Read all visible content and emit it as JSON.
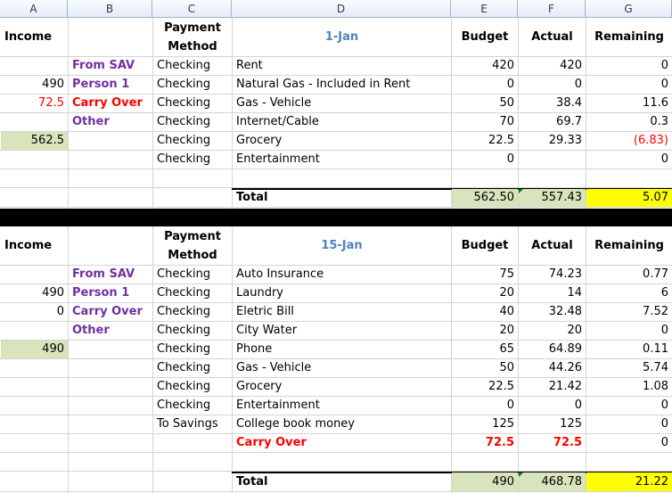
{
  "columns": [
    "A",
    "B",
    "C",
    "D",
    "E",
    "F",
    "G"
  ],
  "sections": [
    {
      "header": {
        "income": "Income",
        "payment1": "Payment",
        "payment2": "Method",
        "date": "1-Jan",
        "budget": "Budget",
        "actual": "Actual",
        "remaining": "Remaining"
      },
      "income_rows": [
        {
          "amount": "",
          "label": "From SAV",
          "style": "purple"
        },
        {
          "amount": "490",
          "label": "Person 1",
          "style": "purple"
        },
        {
          "amount": "72.5",
          "label": "Carry Over",
          "style": "redb"
        },
        {
          "amount": "",
          "label": "Other",
          "style": "purple"
        }
      ],
      "income_total": "562.5",
      "items": [
        {
          "method": "Checking",
          "desc": "Rent",
          "budget": "420",
          "actual": "420",
          "remaining": "0"
        },
        {
          "method": "Checking",
          "desc": "Natural Gas - Included in Rent",
          "budget": "0",
          "actual": "0",
          "remaining": "0"
        },
        {
          "method": "Checking",
          "desc": "Gas - Vehicle",
          "budget": "50",
          "actual": "38.4",
          "remaining": "11.6"
        },
        {
          "method": "Checking",
          "desc": "Internet/Cable",
          "budget": "70",
          "actual": "69.7",
          "remaining": "0.3"
        },
        {
          "method": "Checking",
          "desc": "Grocery",
          "budget": "22.5",
          "actual": "29.33",
          "remaining": "(6.83)"
        },
        {
          "method": "Checking",
          "desc": "Entertainment",
          "budget": "0",
          "actual": "",
          "remaining": "0"
        }
      ],
      "total": {
        "label": "Total",
        "budget": "562.50",
        "actual": "557.43",
        "remaining": "5.07"
      }
    },
    {
      "header": {
        "income": "Income",
        "payment1": "Payment",
        "payment2": "Method",
        "date": "15-Jan",
        "budget": "Budget",
        "actual": "Actual",
        "remaining": "Remaining"
      },
      "income_rows": [
        {
          "amount": "",
          "label": "From SAV",
          "style": "purple"
        },
        {
          "amount": "490",
          "label": "Person 1",
          "style": "purple"
        },
        {
          "amount": "0",
          "label": "Carry Over",
          "style": "purple"
        },
        {
          "amount": "",
          "label": "Other",
          "style": "purple"
        }
      ],
      "income_total": "490",
      "items": [
        {
          "method": "Checking",
          "desc": "Auto Insurance",
          "budget": "75",
          "actual": "74.23",
          "remaining": "0.77"
        },
        {
          "method": "Checking",
          "desc": "Laundry",
          "budget": "20",
          "actual": "14",
          "remaining": "6"
        },
        {
          "method": "Checking",
          "desc": "Eletric Bill",
          "budget": "40",
          "actual": "32.48",
          "remaining": "7.52"
        },
        {
          "method": "Checking",
          "desc": "City Water",
          "budget": "20",
          "actual": "20",
          "remaining": "0"
        },
        {
          "method": "Checking",
          "desc": "Phone",
          "budget": "65",
          "actual": "64.89",
          "remaining": "0.11"
        },
        {
          "method": "Checking",
          "desc": "Gas - Vehicle",
          "budget": "50",
          "actual": "44.26",
          "remaining": "5.74"
        },
        {
          "method": "Checking",
          "desc": "Grocery",
          "budget": "22.5",
          "actual": "21.42",
          "remaining": "1.08"
        },
        {
          "method": "Checking",
          "desc": "Entertainment",
          "budget": "0",
          "actual": "0",
          "remaining": "0"
        },
        {
          "method": "To Savings",
          "desc": "College book money",
          "budget": "125",
          "actual": "125",
          "remaining": "0"
        },
        {
          "method": "",
          "desc": "Carry Over",
          "budget": "72.5",
          "actual": "72.5",
          "remaining": "0",
          "style": "redb"
        }
      ],
      "total": {
        "label": "Total",
        "budget": "490",
        "actual": "468.78",
        "remaining": "21.22"
      }
    }
  ],
  "colors": {
    "green_fill": "#d8e4bc",
    "yellow_fill": "#ffff00",
    "purple": "#7030a0",
    "red": "#ff0000",
    "blue": "#4f81bd"
  }
}
